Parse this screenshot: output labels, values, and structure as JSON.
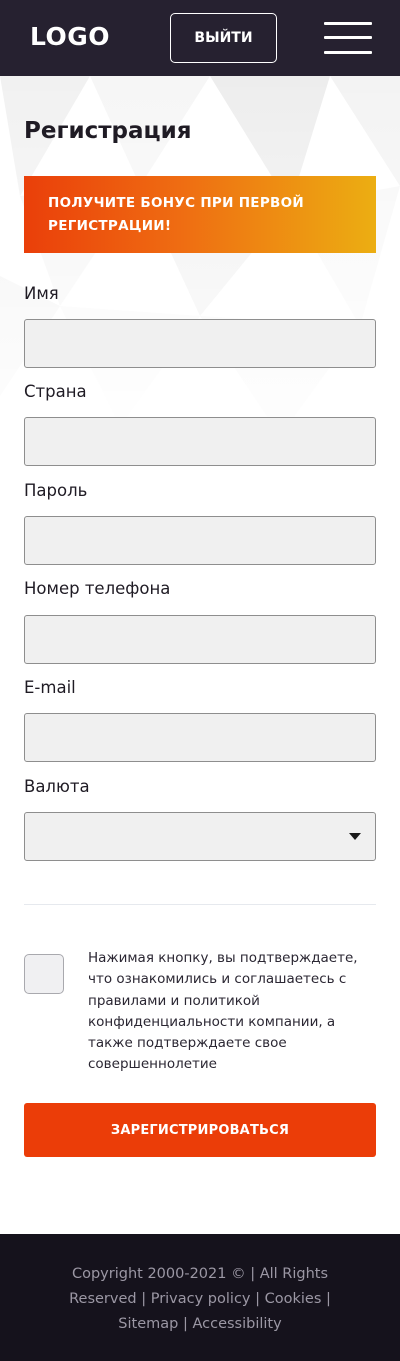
{
  "header": {
    "logo": "LOGO",
    "logout_label": "ВЫЙТИ",
    "menu_icon": "hamburger-menu-icon"
  },
  "registration": {
    "title": "Регистрация",
    "bonus_text": "ПОЛУЧИТЕ БОНУС ПРИ ПЕРВОЙ РЕГИСТРАЦИИ!",
    "fields": {
      "name": {
        "label": "Имя",
        "value": ""
      },
      "country": {
        "label": "Страна",
        "value": ""
      },
      "password": {
        "label": "Пароль",
        "value": ""
      },
      "phone": {
        "label": "Номер телефона",
        "value": ""
      },
      "email": {
        "label": "E-mail",
        "value": ""
      },
      "currency": {
        "label": "Валюта",
        "selected": ""
      }
    },
    "agreement_text": "Нажимая кнопку, вы подтверждаете, что ознакомились и соглашаетесь с правилами и политикой конфиденциальности компании, а также подтверждаете свое совершеннолетие",
    "agreement_checked": false,
    "submit_label": "ЗАРЕГИСТРИРОВАТЬСЯ"
  },
  "footer": {
    "copyright": "Copyright 2000-2021 © | All Rights Reserved",
    "links": {
      "privacy": "Privacy policy",
      "cookies": "Cookies",
      "sitemap": "Sitemap",
      "accessibility": "Accessibility"
    },
    "separator": "|"
  },
  "colors": {
    "header_bg": "#262130",
    "footer_bg": "#15121c",
    "accent": "#eb3d08",
    "banner_gradient_start": "#ea3f0a",
    "banner_gradient_end": "#ecae12",
    "input_bg": "#f0f0f0"
  }
}
